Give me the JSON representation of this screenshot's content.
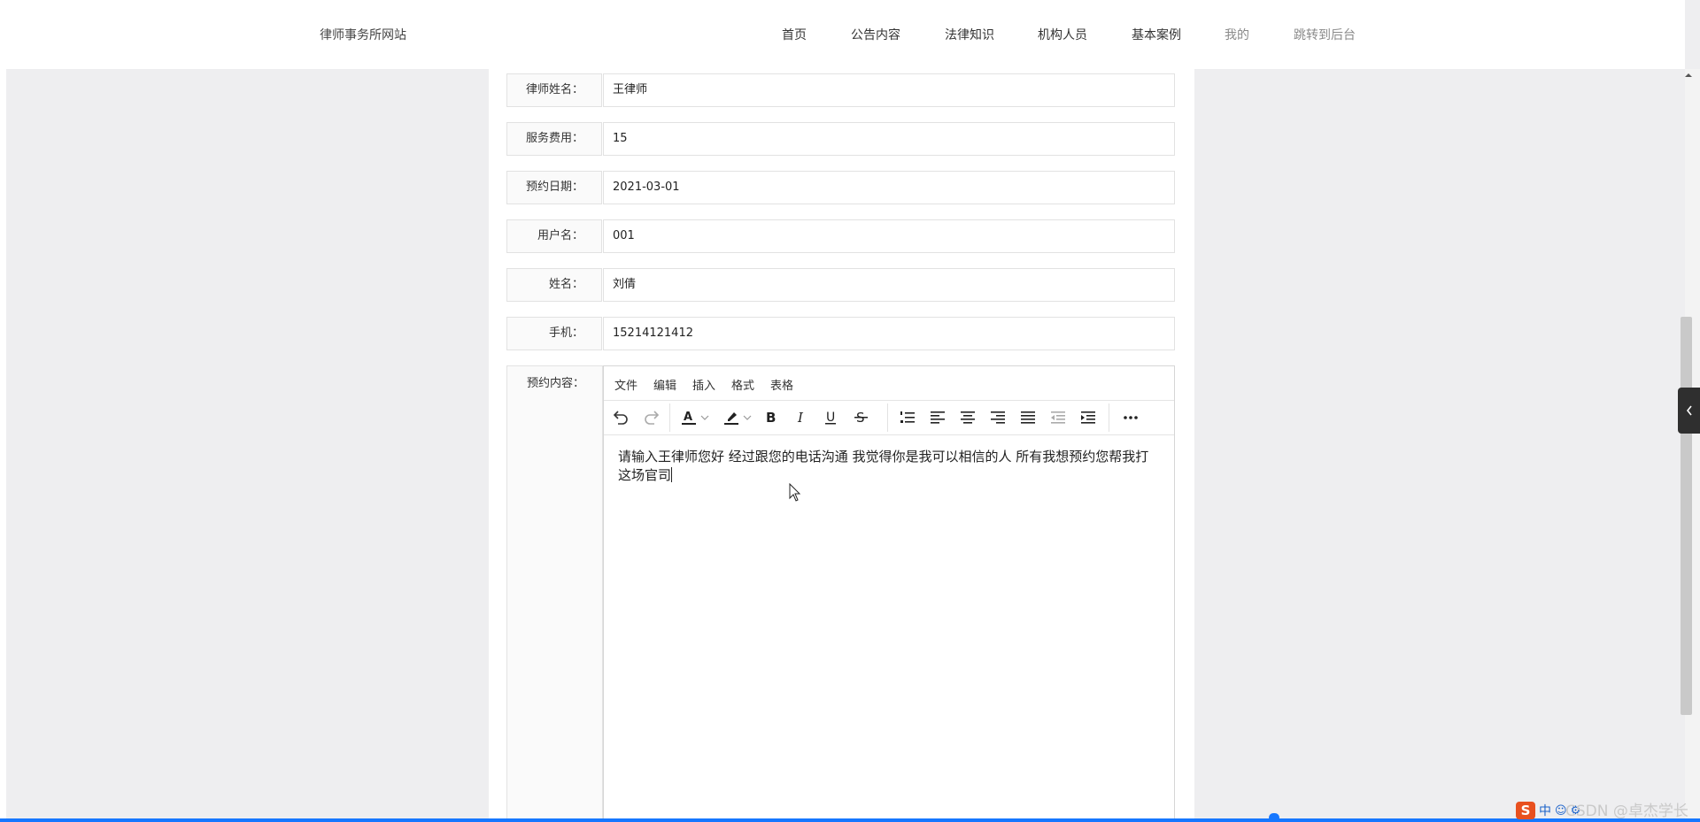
{
  "header": {
    "site_title": "律师事务所网站",
    "nav": [
      {
        "label": "首页"
      },
      {
        "label": "公告内容"
      },
      {
        "label": "法律知识"
      },
      {
        "label": "机构人员"
      },
      {
        "label": "基本案例"
      },
      {
        "label": "我的"
      },
      {
        "label": "跳转到后台"
      }
    ]
  },
  "form": {
    "fields": [
      {
        "label": "律师姓名：",
        "value": "王律师"
      },
      {
        "label": "服务费用：",
        "value": "15"
      },
      {
        "label": "预约日期：",
        "value": "2021-03-01"
      },
      {
        "label": "用户名：",
        "value": "001"
      },
      {
        "label": "姓名：",
        "value": "刘倩"
      },
      {
        "label": "手机：",
        "value": "15214121412"
      }
    ],
    "content_label": "预约内容："
  },
  "editor": {
    "menus": [
      "文件",
      "编辑",
      "插入",
      "格式",
      "表格"
    ],
    "toolbar_icons": [
      "undo-icon",
      "redo-icon",
      "text-color-icon",
      "highlight-icon",
      "bold-icon",
      "italic-icon",
      "underline-icon",
      "strikethrough-icon",
      "numbered-list-icon",
      "align-left-icon",
      "align-center-icon",
      "align-right-icon",
      "align-justify-icon",
      "outdent-icon",
      "indent-icon",
      "more-icon"
    ],
    "text": "请输入王律师您好 经过跟您的电话沟通 我觉得你是我可以相信的人 所有我想预约您帮我打这场官司",
    "accent_color": "#1677ff"
  },
  "tray": {
    "ime_label": "中",
    "watermark": "CSDN @卓杰学长"
  }
}
